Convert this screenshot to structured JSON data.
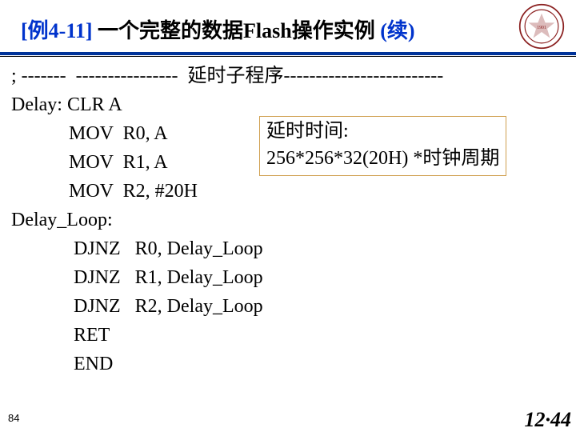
{
  "header": {
    "title_prefix": "[例4-11] ",
    "title_main": "一个完整的数据Flash操作实例 ",
    "title_suffix": "(续)"
  },
  "code": {
    "l1": "; -------  ----------------  延时子程序-------------------------",
    "l2": "Delay: CLR A",
    "l3": "            MOV  R0, A",
    "l4": "            MOV  R1, A",
    "l5": "            MOV  R2, #20H",
    "l6": "Delay_Loop:",
    "l7": "             DJNZ   R0, Delay_Loop",
    "l8": "             DJNZ   R1, Delay_Loop",
    "l9": "             DJNZ   R2, Delay_Loop",
    "l10": "             RET",
    "l11": "             END"
  },
  "annotation": {
    "line1": "延时时间:",
    "line2": "256*256*32(20H) *时钟周期"
  },
  "page_number": "84",
  "footer_time": "12·44"
}
